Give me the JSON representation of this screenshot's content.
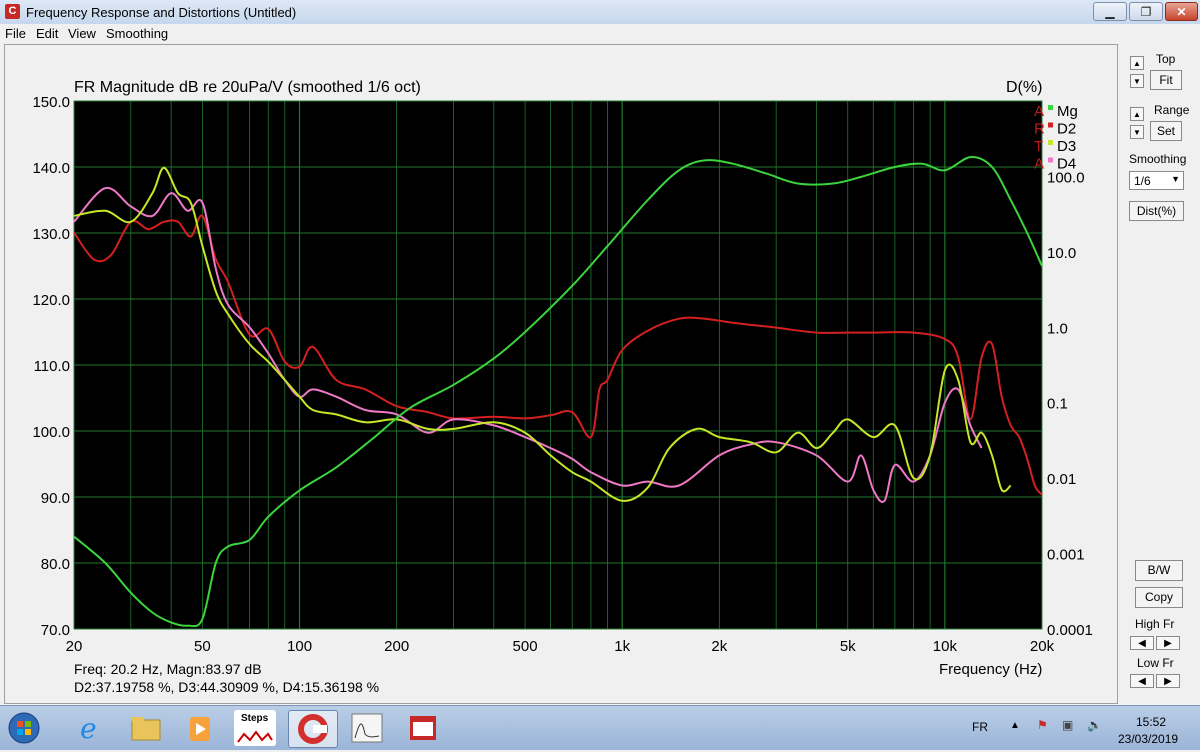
{
  "window": {
    "title": "Frequency Response and Distortions (Untitled)",
    "buttons": [
      "minimize-icon",
      "maximize-icon",
      "close-icon"
    ]
  },
  "menu": [
    "File",
    "Edit",
    "View",
    "Smoothing"
  ],
  "plot": {
    "title": "FR Magnitude dB re 20uPa/V (smoothed 1/6 oct)",
    "right_axis_title": "D(%)",
    "x_axis_title": "Frequency (Hz)",
    "readout_line1": "Freq: 20.2 Hz, Magn:83.97 dB",
    "readout_line2": "D2:37.19758 %, D3:44.30909 %, D4:15.36198 %",
    "legend": [
      {
        "flag": "A",
        "label": "Mg",
        "color": "#3cd43c"
      },
      {
        "flag": "R",
        "label": "D2",
        "color": "#d42020"
      },
      {
        "flag": "T",
        "label": "D3",
        "color": "#c8e628"
      },
      {
        "flag": "A",
        "label": "D4",
        "color": "#ee78c8"
      }
    ]
  },
  "chart_data": {
    "type": "line",
    "x_scale": "log",
    "xlim": [
      20,
      20000
    ],
    "ylim": [
      70,
      150
    ],
    "y2_scale": "log",
    "y2lim": [
      0.0001,
      1000
    ],
    "grid": true,
    "legend_position": "top-right",
    "x_ticks": [
      "20",
      "50",
      "100",
      "200",
      "500",
      "1k",
      "2k",
      "5k",
      "10k",
      "20k"
    ],
    "y_ticks": [
      "70.0",
      "80.0",
      "90.0",
      "100.0",
      "110.0",
      "120.0",
      "130.0",
      "140.0",
      "150.0"
    ],
    "y2_ticks": [
      "0.0001",
      "0.001",
      "0.01",
      "0.1",
      "1.0",
      "10.0",
      "100.0"
    ],
    "series": [
      {
        "name": "Mg",
        "axis": "left",
        "color": "#3cd43c",
        "x": [
          20,
          25,
          30,
          35,
          40,
          45,
          50,
          55,
          60,
          70,
          80,
          100,
          130,
          170,
          220,
          300,
          400,
          500,
          700,
          900,
          1200,
          1500,
          1800,
          2200,
          2800,
          3500,
          4500,
          5500,
          7000,
          8500,
          10000,
          12000,
          14000,
          16000,
          18000,
          20000
        ],
        "y": [
          84,
          80,
          75.5,
          72.5,
          71,
          70.5,
          71.5,
          80,
          82.5,
          83.5,
          87,
          91,
          94.5,
          99,
          103.5,
          107,
          111,
          115,
          122,
          128,
          135,
          139.5,
          141,
          140.5,
          139,
          137.5,
          137.5,
          138.5,
          140,
          140.5,
          139.5,
          141.5,
          140,
          135,
          130,
          125
        ]
      },
      {
        "name": "D2",
        "axis": "right",
        "color": "#d42020",
        "x": [
          20,
          23,
          26,
          30,
          34,
          38,
          42,
          46,
          50,
          55,
          60,
          70,
          80,
          90,
          100,
          110,
          130,
          160,
          200,
          250,
          300,
          400,
          500,
          600,
          700,
          800,
          850,
          900,
          1000,
          1200,
          1500,
          1800,
          2200,
          3000,
          4000,
          5000,
          6000,
          8000,
          10000,
          11000,
          12000,
          13000,
          14000,
          15000,
          16000,
          17000,
          18000,
          19000,
          20000
        ],
        "y": [
          18,
          8,
          9,
          25,
          20,
          25,
          25,
          16,
          30,
          8,
          4,
          0.8,
          0.95,
          0.35,
          0.3,
          0.55,
          0.2,
          0.15,
          0.09,
          0.075,
          0.062,
          0.065,
          0.062,
          0.068,
          0.075,
          0.035,
          0.15,
          0.2,
          0.5,
          0.9,
          1.3,
          1.3,
          1.15,
          0.99,
          0.85,
          0.85,
          0.85,
          0.85,
          0.7,
          0.4,
          0.06,
          0.4,
          0.6,
          0.12,
          0.05,
          0.035,
          0.018,
          0.008,
          0.006
        ]
      },
      {
        "name": "D3",
        "axis": "right",
        "color": "#c8e628",
        "x": [
          20,
          25,
          30,
          35,
          38,
          42,
          46,
          50,
          55,
          60,
          70,
          80,
          90,
          100,
          110,
          130,
          160,
          200,
          250,
          300,
          400,
          500,
          600,
          700,
          800,
          1000,
          1200,
          1400,
          1700,
          2000,
          2500,
          3000,
          3500,
          4000,
          4500,
          5000,
          6000,
          7000,
          8000,
          9000,
          10000,
          11000,
          12000,
          13000,
          14000,
          15000,
          16000
        ],
        "y": [
          30,
          35,
          25,
          60,
          130,
          60,
          45,
          12,
          3,
          1.5,
          0.6,
          0.35,
          0.2,
          0.12,
          0.08,
          0.07,
          0.055,
          0.06,
          0.045,
          0.045,
          0.055,
          0.04,
          0.02,
          0.012,
          0.009,
          0.005,
          0.0075,
          0.025,
          0.045,
          0.035,
          0.03,
          0.022,
          0.04,
          0.025,
          0.04,
          0.06,
          0.035,
          0.05,
          0.01,
          0.02,
          0.27,
          0.2,
          0.03,
          0.04,
          0.02,
          0.007,
          0.008
        ]
      },
      {
        "name": "D4",
        "axis": "right",
        "color": "#ee78c8",
        "x": [
          20,
          25,
          30,
          35,
          40,
          45,
          50,
          55,
          60,
          70,
          80,
          90,
          100,
          110,
          130,
          160,
          200,
          250,
          300,
          400,
          500,
          600,
          700,
          800,
          1000,
          1200,
          1500,
          2000,
          2500,
          3000,
          4000,
          5000,
          5500,
          6000,
          6500,
          7000,
          8000,
          9000,
          10000,
          11000,
          12000,
          13000
        ],
        "y": [
          25,
          70,
          40,
          30,
          60,
          35,
          45,
          6,
          2,
          1,
          0.45,
          0.2,
          0.12,
          0.15,
          0.12,
          0.08,
          0.07,
          0.04,
          0.06,
          0.05,
          0.035,
          0.025,
          0.018,
          0.012,
          0.008,
          0.009,
          0.008,
          0.02,
          0.028,
          0.03,
          0.02,
          0.009,
          0.02,
          0.007,
          0.005,
          0.015,
          0.009,
          0.02,
          0.1,
          0.15,
          0.05,
          0.025
        ]
      }
    ]
  },
  "panel": {
    "top_label": "Top",
    "fit_label": "Fit",
    "range_label": "Range",
    "set_label": "Set",
    "smoothing_label": "Smoothing",
    "smoothing_value": "1/6",
    "dist_label": "Dist(%)",
    "bw_label": "B/W",
    "copy_label": "Copy",
    "high_fr_label": "High Fr",
    "low_fr_label": "Low Fr"
  },
  "taskbar": {
    "apps": [
      "start-orb-icon",
      "ie-icon",
      "folder-icon",
      "media-player-icon",
      "steps-icon",
      "arta-icon",
      "limp-icon",
      "steps-app-icon"
    ],
    "steps_text": "Steps",
    "lang": "FR",
    "time": "15:52",
    "date": "23/03/2019"
  }
}
